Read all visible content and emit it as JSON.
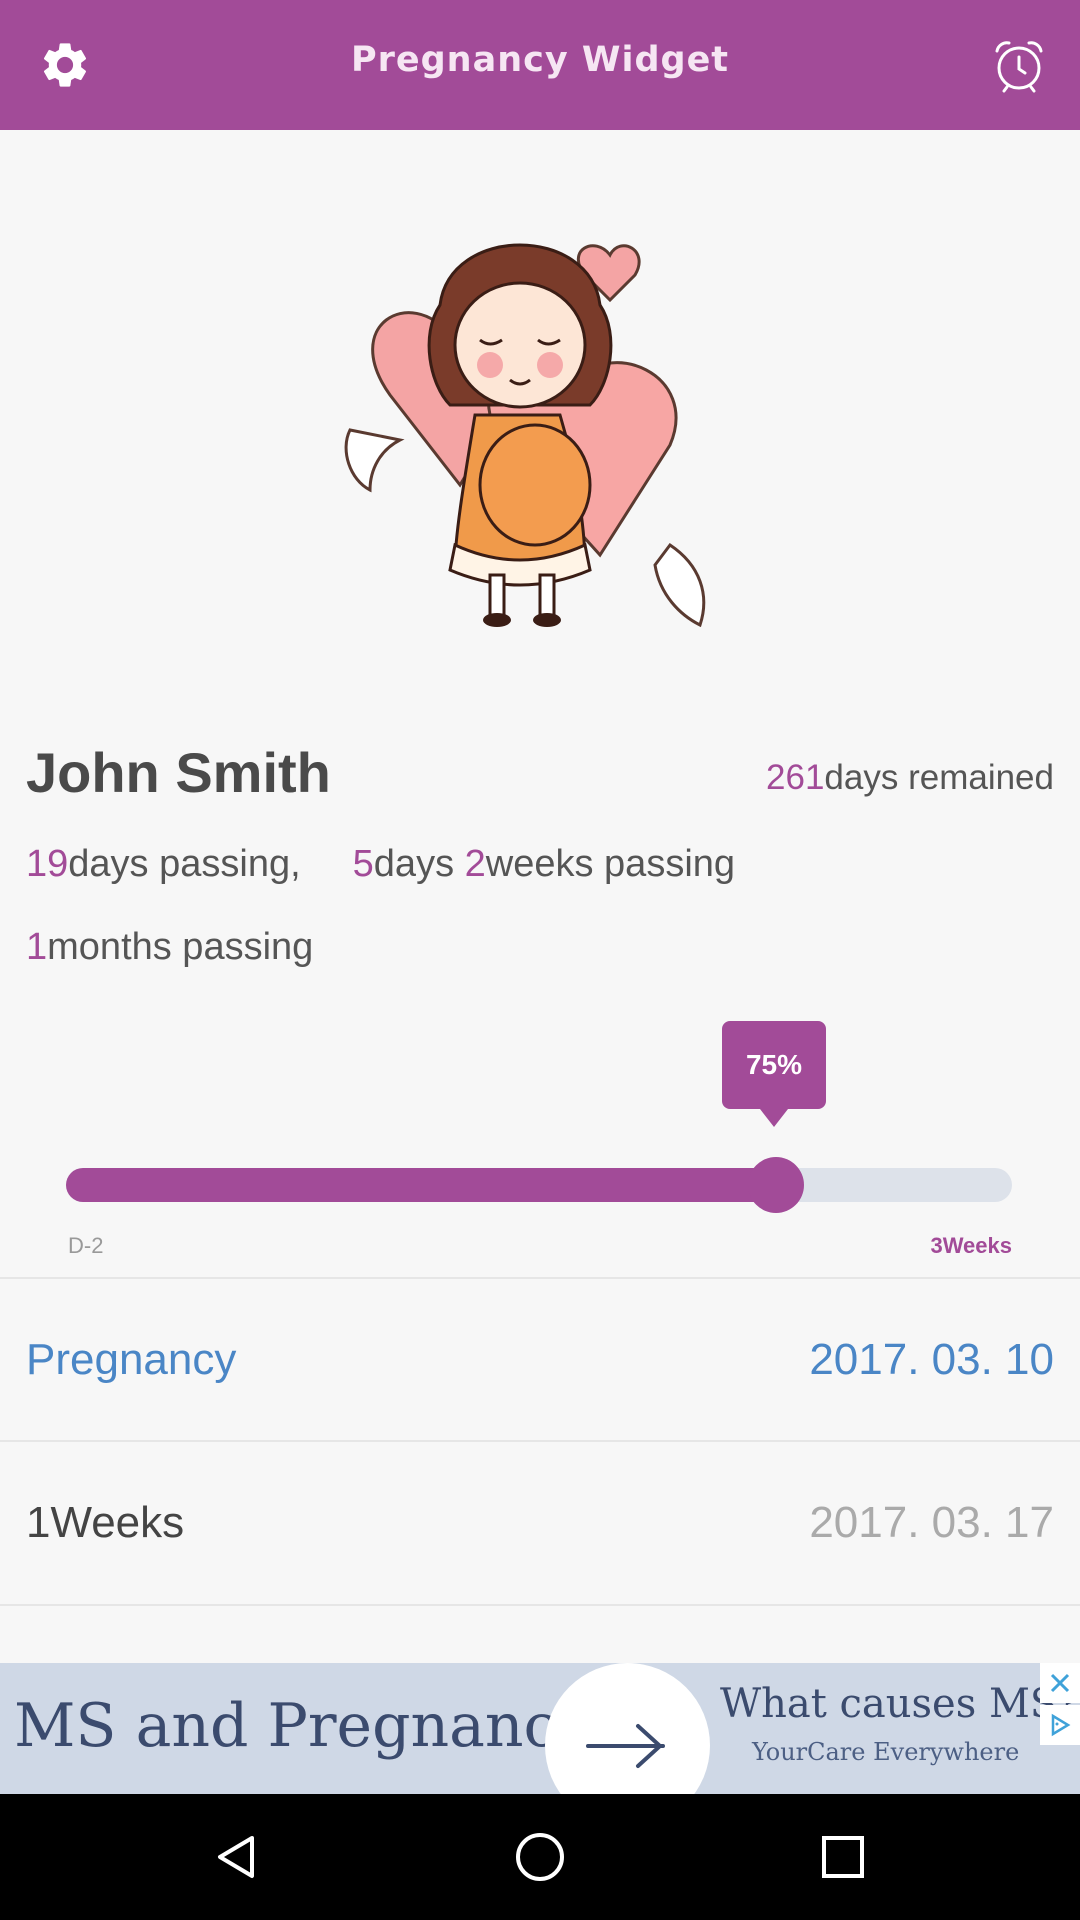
{
  "header": {
    "title": "Pregnancy Widget",
    "settings_icon": "gear-icon",
    "alarm_icon": "alarm-clock-icon"
  },
  "profile": {
    "name": "John Smith",
    "days_remained_num": "261",
    "days_remained_text": "days remained",
    "days_passing_num": "19",
    "days_passing_text": "days passing,",
    "days_num": "5",
    "days_text": "days",
    "weeks_num": "2",
    "weeks_text": "weeks passing",
    "months_num": "1",
    "months_text": "months passing"
  },
  "progress": {
    "percent_label": "75%",
    "value": 0.75,
    "start_label": "D-2",
    "end_label": "3Weeks"
  },
  "list": [
    {
      "label": "Pregnancy",
      "date": "2017. 03. 10"
    },
    {
      "label": "1Weeks",
      "date": "2017. 03. 17"
    }
  ],
  "ad": {
    "title": "MS and Pregnancy",
    "question": "What causes MS?",
    "sponsor": "YourCare Everywhere"
  },
  "colors": {
    "accent": "#a24b98",
    "blue": "#4a86c6"
  }
}
